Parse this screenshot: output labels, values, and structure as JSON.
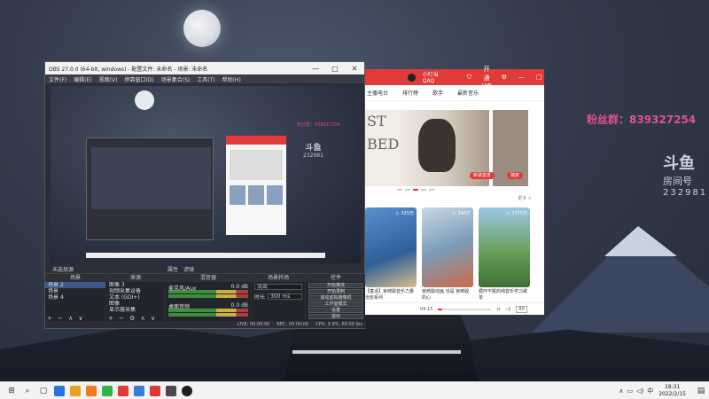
{
  "desktop": {
    "overlay_text": "粉丝群：839327254",
    "douyu_logo": "斗鱼",
    "douyu_room": "房间号",
    "douyu_room_no": "232981"
  },
  "obs": {
    "title": "OBS 27.0.0 (64-bit, windows) - 配置文件: 未命名 - 场景: 未命名",
    "window_controls": {
      "minimize": "—",
      "maximize": "□",
      "close": "✕"
    },
    "menu": [
      "文件(F)",
      "编辑(E)",
      "视图(V)",
      "停靠窗口(D)",
      "场景集合(S)",
      "工具(T)",
      "帮助(H)"
    ],
    "status_source": "未选择源",
    "status_properties": "属性",
    "status_filters": "滤镜",
    "docks": {
      "scenes": {
        "title": "场景",
        "items": [
          "场景 2",
          "场景",
          "场景 4"
        ]
      },
      "sources": {
        "title": "来源",
        "items": [
          "图像 3",
          "视频采集设备",
          "文本 (GDI+)",
          "图像",
          "显示器采集"
        ]
      },
      "mixer": {
        "title": "混音器",
        "tracks": [
          {
            "name": "麦克风/Aux",
            "level": "0.0 dB"
          },
          {
            "name": "桌面音频",
            "level": "0.0 dB"
          }
        ]
      },
      "transitions": {
        "title": "场景转场",
        "type": "淡出",
        "duration_label": "时长",
        "duration": "300 ms"
      },
      "controls": {
        "title": "控件",
        "buttons": [
          "开始推流",
          "开始录制",
          "启动虚拟摄像机",
          "工作室模式",
          "设置",
          "退出"
        ]
      }
    },
    "statusbar": {
      "live": "LIVE: 00:00:00",
      "rec": "REC: 00:00:00",
      "cpu": "CPU: 3.9%, 60.00 fps"
    }
  },
  "preview": {
    "text_logo": "斗鱼",
    "text_room": "232981"
  },
  "music": {
    "username": "小叮当QAQ",
    "badge": "开通VIP",
    "nav": [
      "主播电台",
      "排行榜",
      "歌手",
      "最新音乐"
    ],
    "banner_text": "ST\nBED",
    "banner_btn": "新歌首发",
    "banner_btn2": "独家",
    "more_label": "更多 >",
    "cards": [
      {
        "count": "▷ 325万",
        "caption": "【童话】宫崎骏音乐力量 治愈系列"
      },
      {
        "count": "▷ 336万",
        "caption": "宫崎骏动画 也是 宫崎骏的心"
      },
      {
        "count": "▷ 2375万",
        "caption": "循环不腻的纯音乐学习歌单"
      }
    ],
    "player": {
      "time": "04:15",
      "vol": "80"
    }
  },
  "taskbar": {
    "start": "⊞",
    "search": "⌕",
    "time": "18:31",
    "date": "2022/2/15",
    "lang": "中"
  }
}
